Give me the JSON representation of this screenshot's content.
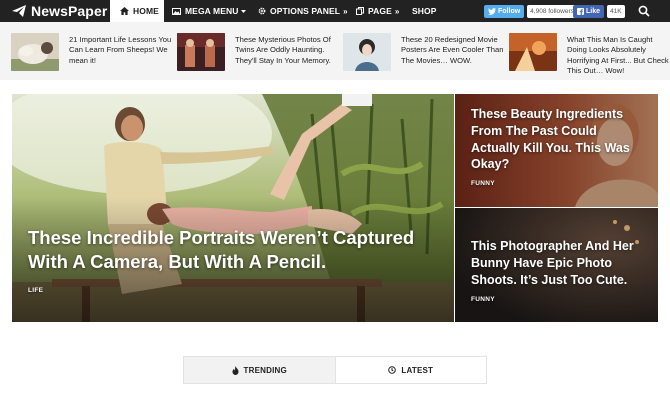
{
  "brand": {
    "name": "NewsPaper"
  },
  "nav": {
    "items": [
      {
        "label": "HOME",
        "icon": "home-icon",
        "active": true
      },
      {
        "label": "MEGA MENU",
        "icon": "image-icon"
      },
      {
        "label": "OPTIONS PANEL",
        "icon": "gear-icon"
      },
      {
        "label": "PAGE",
        "icon": "copy-icon"
      },
      {
        "label": "SHOP"
      }
    ],
    "twitter": {
      "label": "Follow",
      "count": "4,908 followers",
      "color": "#55acee"
    },
    "facebook": {
      "label": "Like",
      "count": "41K",
      "color": "#4267b2"
    },
    "search_icon": "search-icon"
  },
  "ticker": [
    {
      "text": "21 Important Life Lessons You Can Learn From Sheeps! We mean it!"
    },
    {
      "text": "These Mysterious Photos Of Twins Are Oddly Haunting. They'll Stay In Your Memory."
    },
    {
      "text": "These 20 Redesigned Movie Posters Are Even Cooler Than The Movies… WOW."
    },
    {
      "text": "What This Man Is Caught Doing Looks Absolutely Horrifying At First... But Check This Out… Wow!"
    }
  ],
  "hero": {
    "title": "These Incredible Portraits Weren’t Captured With A Camera, But With A Pencil.",
    "category": "LIFE"
  },
  "side": [
    {
      "title": "These Beauty Ingredients From The Past Could Actually Kill You. This Was Okay?",
      "category": "FUNNY"
    },
    {
      "title": "This Photographer And Her Bunny Have Epic Photo Shoots. It’s Just Too Cute.",
      "category": "FUNNY"
    }
  ],
  "tabs": [
    {
      "label": "TRENDING",
      "icon": "flame-icon",
      "active": true
    },
    {
      "label": "LATEST",
      "icon": "clock-icon"
    }
  ],
  "colors": {
    "nav_bg": "#222222",
    "ticker_bg": "#f4f4f4",
    "text": "#222222"
  }
}
